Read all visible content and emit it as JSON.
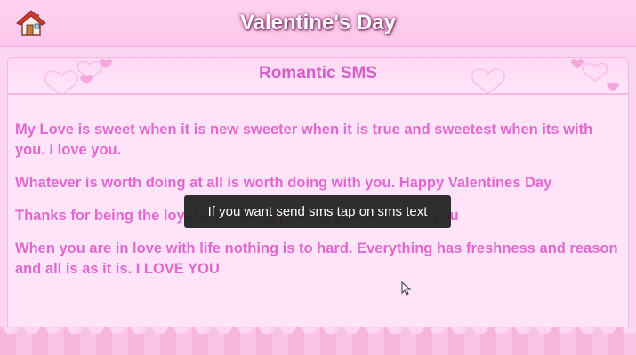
{
  "app": {
    "title": "Valentine's Day"
  },
  "panel": {
    "title": "Romantic SMS"
  },
  "messages": [
    "My Love is sweet when it is new sweeter when it is true and sweetest when its with you. I love you.",
    "Whatever is worth doing at all is worth doing with you. Happy Valentines Day",
    "Thanks for being the loyal and caring [friend] you are. Love you",
    "When you are in love with life nothing is to hard. Everything has freshness and reason and all is as it is. I LOVE YOU"
  ],
  "toast": {
    "text": "If you want send sms tap on sms text"
  },
  "icons": {
    "home": "home-icon",
    "cursor": "mouse-cursor-icon"
  },
  "colors": {
    "accent": "#e168d1",
    "title_pink": "#d85cc8",
    "background": "#fdd6f3"
  }
}
